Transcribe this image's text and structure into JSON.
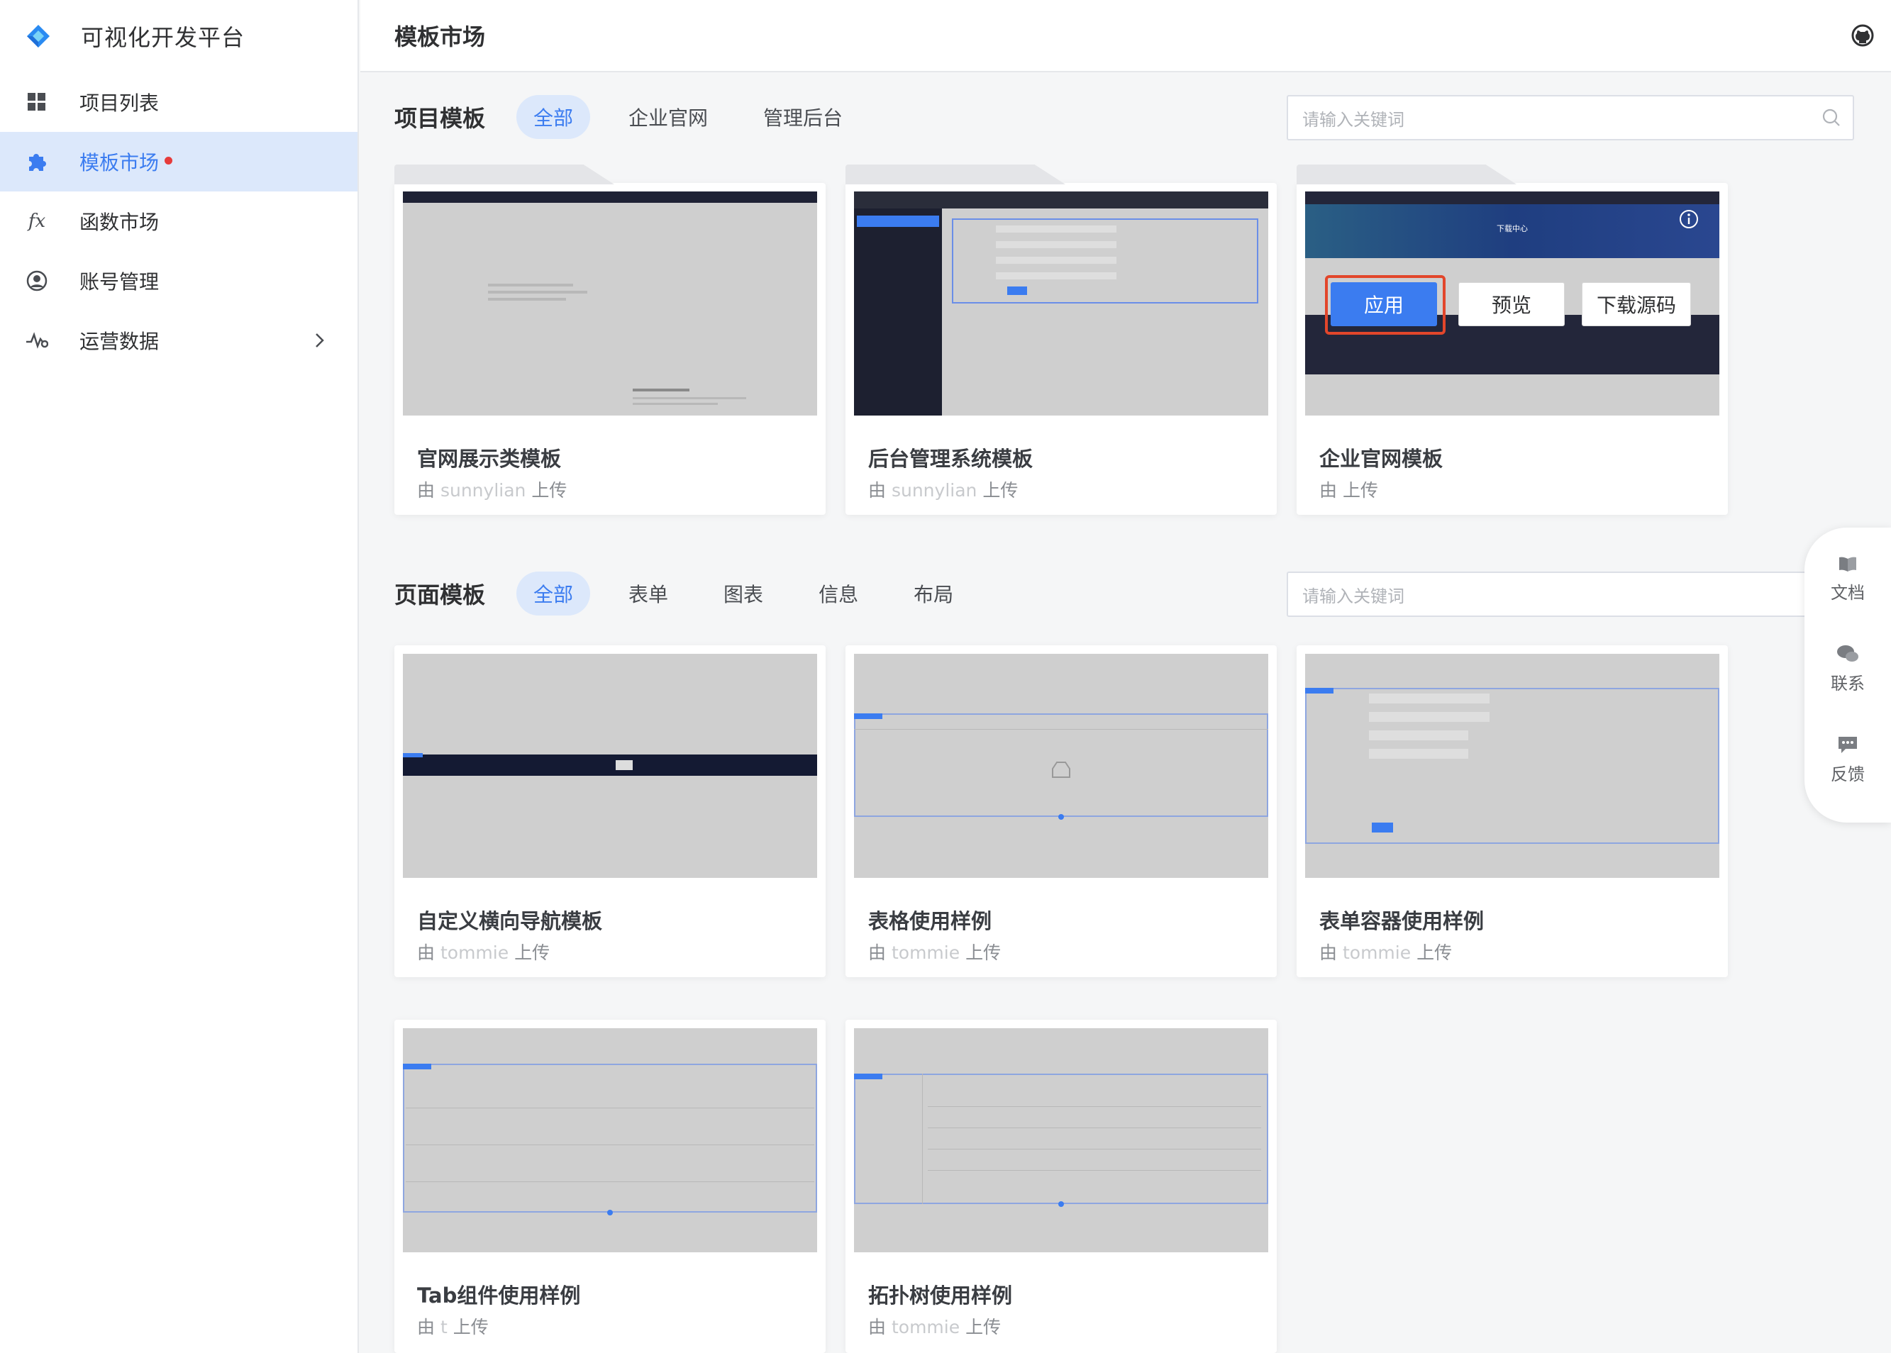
{
  "brand": {
    "title": "可视化开发平台"
  },
  "sidebar": {
    "items": [
      {
        "label": "项目列表",
        "icon": "grid-icon"
      },
      {
        "label": "模板市场",
        "icon": "puzzle-icon",
        "active": true,
        "dot": true
      },
      {
        "label": "函数市场",
        "icon": "function-icon"
      },
      {
        "label": "账号管理",
        "icon": "user-icon"
      },
      {
        "label": "运营数据",
        "icon": "chart-icon",
        "chevron": true
      }
    ]
  },
  "header": {
    "title": "模板市场"
  },
  "project_section": {
    "title": "项目模板",
    "tabs": [
      "全部",
      "企业官网",
      "管理后台"
    ],
    "search_placeholder": "请输入关键词",
    "cards": [
      {
        "title": "官网展示类模板",
        "uploader_prefix": "由",
        "uploader": "sunnylian",
        "uploader_suffix": "上传"
      },
      {
        "title": "后台管理系统模板",
        "uploader_prefix": "由",
        "uploader": "sunnylian",
        "uploader_suffix": "上传"
      },
      {
        "title": "企业官网模板",
        "uploader_prefix": "由",
        "uploader": "",
        "uploader_suffix": "上传",
        "thumb_title": "下载中心"
      }
    ],
    "overlay_buttons": {
      "apply": "应用",
      "preview": "预览",
      "download": "下载源码"
    }
  },
  "page_section": {
    "title": "页面模板",
    "tabs": [
      "全部",
      "表单",
      "图表",
      "信息",
      "布局"
    ],
    "search_placeholder": "请输入关键词",
    "cards": [
      {
        "title": "自定义横向导航模板",
        "uploader_prefix": "由",
        "uploader": "tommie",
        "uploader_suffix": "上传"
      },
      {
        "title": "表格使用样例",
        "uploader_prefix": "由",
        "uploader": "tommie",
        "uploader_suffix": "上传"
      },
      {
        "title": "表单容器使用样例",
        "uploader_prefix": "由",
        "uploader": "tommie",
        "uploader_suffix": "上传"
      },
      {
        "title": "Tab组件使用样例",
        "uploader_prefix": "由",
        "uploader": "t",
        "uploader_suffix": "上传"
      },
      {
        "title": "拓扑树使用样例",
        "uploader_prefix": "由",
        "uploader": "tommie",
        "uploader_suffix": "上传"
      }
    ]
  },
  "float_bar": {
    "items": [
      {
        "label": "文档",
        "icon": "book-icon"
      },
      {
        "label": "联系",
        "icon": "chat-icon"
      },
      {
        "label": "反馈",
        "icon": "feedback-icon"
      }
    ]
  },
  "colors": {
    "accent": "#3b7cf0",
    "active_bg": "#dce8fb",
    "highlight": "#e2462b"
  }
}
